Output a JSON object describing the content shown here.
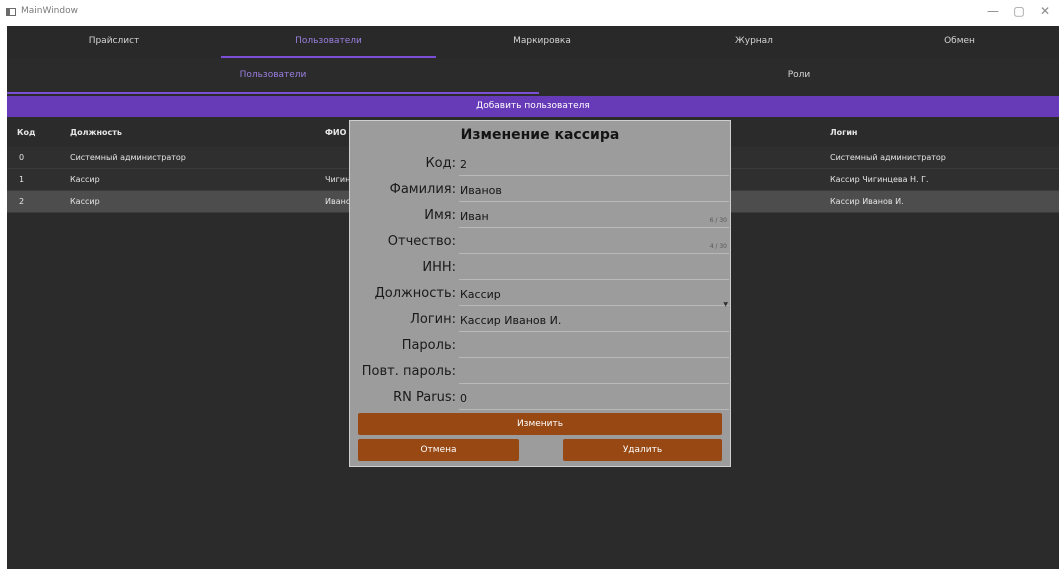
{
  "window": {
    "title": "MainWindow",
    "minimize": "—",
    "maximize": "▢",
    "close": "✕"
  },
  "main_tabs": [
    "Прайслист",
    "Пользователи",
    "Маркировка",
    "Журнал",
    "Обмен"
  ],
  "sub_tabs": [
    "Пользователи",
    "Роли"
  ],
  "add_user_label": "Добавить пользователя",
  "table": {
    "headers": {
      "code": "Код",
      "position": "Должность",
      "fio": "ФИО",
      "login": "Логин"
    },
    "rows": [
      {
        "code": "0",
        "position": "Системный администратор",
        "fio": "",
        "login": "Системный администратор"
      },
      {
        "code": "1",
        "position": "Кассир",
        "fio": "Чигин",
        "login": "Кассир Чигинцева Н. Г."
      },
      {
        "code": "2",
        "position": "Кассир",
        "fio": "Иванс",
        "login": "Кассир Иванов И."
      }
    ]
  },
  "dialog": {
    "title": "Изменение кассира",
    "fields": [
      {
        "label": "Код:",
        "value": "2",
        "counter": ""
      },
      {
        "label": "Фамилия:",
        "value": "Иванов",
        "counter": ""
      },
      {
        "label": "Имя:",
        "value": "Иван",
        "counter": "6 / 30"
      },
      {
        "label": "Отчество:",
        "value": "",
        "counter": "4 / 30"
      },
      {
        "label": "ИНН:",
        "value": "",
        "counter": ""
      },
      {
        "label": "Должность:",
        "value": "Кассир",
        "counter": ""
      },
      {
        "label": "Логин:",
        "value": "Кассир Иванов И.",
        "counter": ""
      },
      {
        "label": "Пароль:",
        "value": "",
        "counter": ""
      },
      {
        "label": "Повт. пароль:",
        "value": "",
        "counter": ""
      },
      {
        "label": "RN Parus:",
        "value": "0",
        "counter": ""
      }
    ],
    "buttons": {
      "change": "Изменить",
      "cancel": "Отмена",
      "delete": "Удалить"
    }
  },
  "colors": {
    "accent": "#673ab7",
    "button": "#974813",
    "dialog_bg": "#9c9c9c",
    "app_bg": "#2b2b2b"
  }
}
